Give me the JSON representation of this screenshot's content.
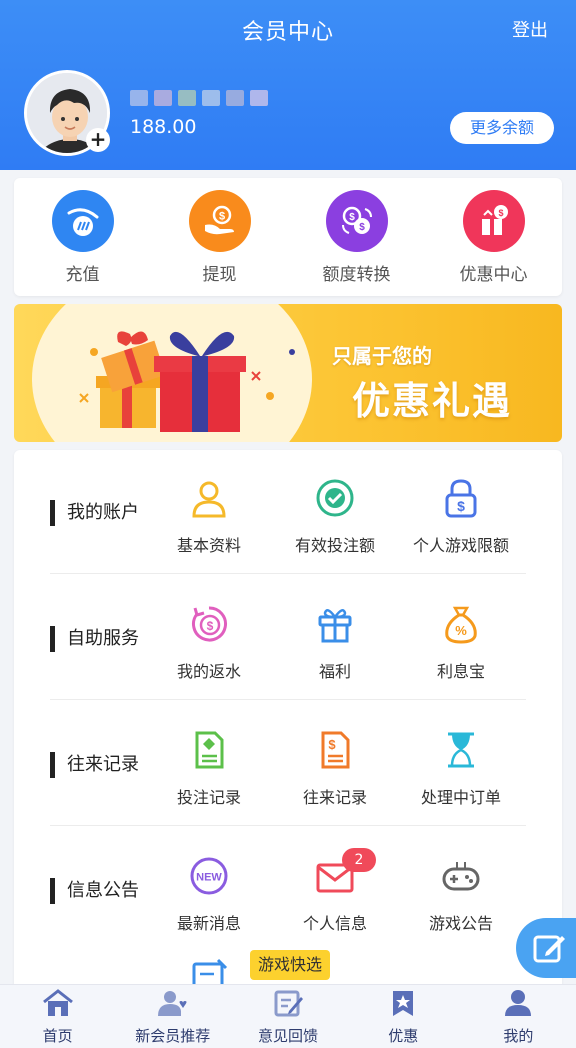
{
  "header": {
    "title": "会员中心",
    "logout": "登出",
    "balance": "188.00",
    "more_balance": "更多余额",
    "username_blur_colors": [
      "#b8c4e8",
      "#d0b8d8",
      "#b8d0b0",
      "#c0d0e8",
      "#b8b8d8",
      "#d8c8e8"
    ]
  },
  "quick_actions": [
    {
      "label": "充值",
      "icon": "recharge-icon",
      "color": "#2f86f2"
    },
    {
      "label": "提现",
      "icon": "withdraw-icon",
      "color": "#f98b1c"
    },
    {
      "label": "额度转换",
      "icon": "transfer-icon",
      "color": "#8b3fe0"
    },
    {
      "label": "优惠中心",
      "icon": "promo-gift-icon",
      "color": "#f0365a"
    }
  ],
  "banner": {
    "sub": "只属于您的",
    "main": "优惠礼遇"
  },
  "menu": [
    {
      "category": "我的账户",
      "items": [
        {
          "label": "基本资料",
          "icon": "user-profile-icon",
          "color": "#f5b92a"
        },
        {
          "label": "有效投注额",
          "icon": "chip-icon",
          "color": "#2fb58b"
        },
        {
          "label": "个人游戏限额",
          "icon": "lock-dollar-icon",
          "color": "#4a74e6"
        }
      ]
    },
    {
      "category": "自助服务",
      "items": [
        {
          "label": "我的返水",
          "icon": "rebate-icon",
          "color": "#e05fbe"
        },
        {
          "label": "福利",
          "icon": "gift-icon",
          "color": "#3a8ee8"
        },
        {
          "label": "利息宝",
          "icon": "money-bag-icon",
          "color": "#f59a1c"
        }
      ]
    },
    {
      "category": "往来记录",
      "items": [
        {
          "label": "投注记录",
          "icon": "bet-record-icon",
          "color": "#5cc04a"
        },
        {
          "label": "往来记录",
          "icon": "transaction-record-icon",
          "color": "#f07a2a"
        },
        {
          "label": "处理中订单",
          "icon": "hourglass-icon",
          "color": "#2ab8d8"
        }
      ]
    },
    {
      "category": "信息公告",
      "items": [
        {
          "label": "最新消息",
          "icon": "new-badge-icon",
          "color": "#8a5ce0"
        },
        {
          "label": "个人信息",
          "icon": "mail-icon",
          "color": "#f04a5a",
          "badge": "2"
        },
        {
          "label": "游戏公告",
          "icon": "gamepad-icon",
          "color": "#666666"
        }
      ]
    }
  ],
  "game_quick": "游戏快选",
  "bottom_nav": [
    {
      "label": "首页",
      "icon": "home-icon"
    },
    {
      "label": "新会员推荐",
      "icon": "referral-icon"
    },
    {
      "label": "意见回馈",
      "icon": "feedback-icon"
    },
    {
      "label": "优惠",
      "icon": "promo-star-icon"
    },
    {
      "label": "我的",
      "icon": "profile-icon"
    }
  ]
}
